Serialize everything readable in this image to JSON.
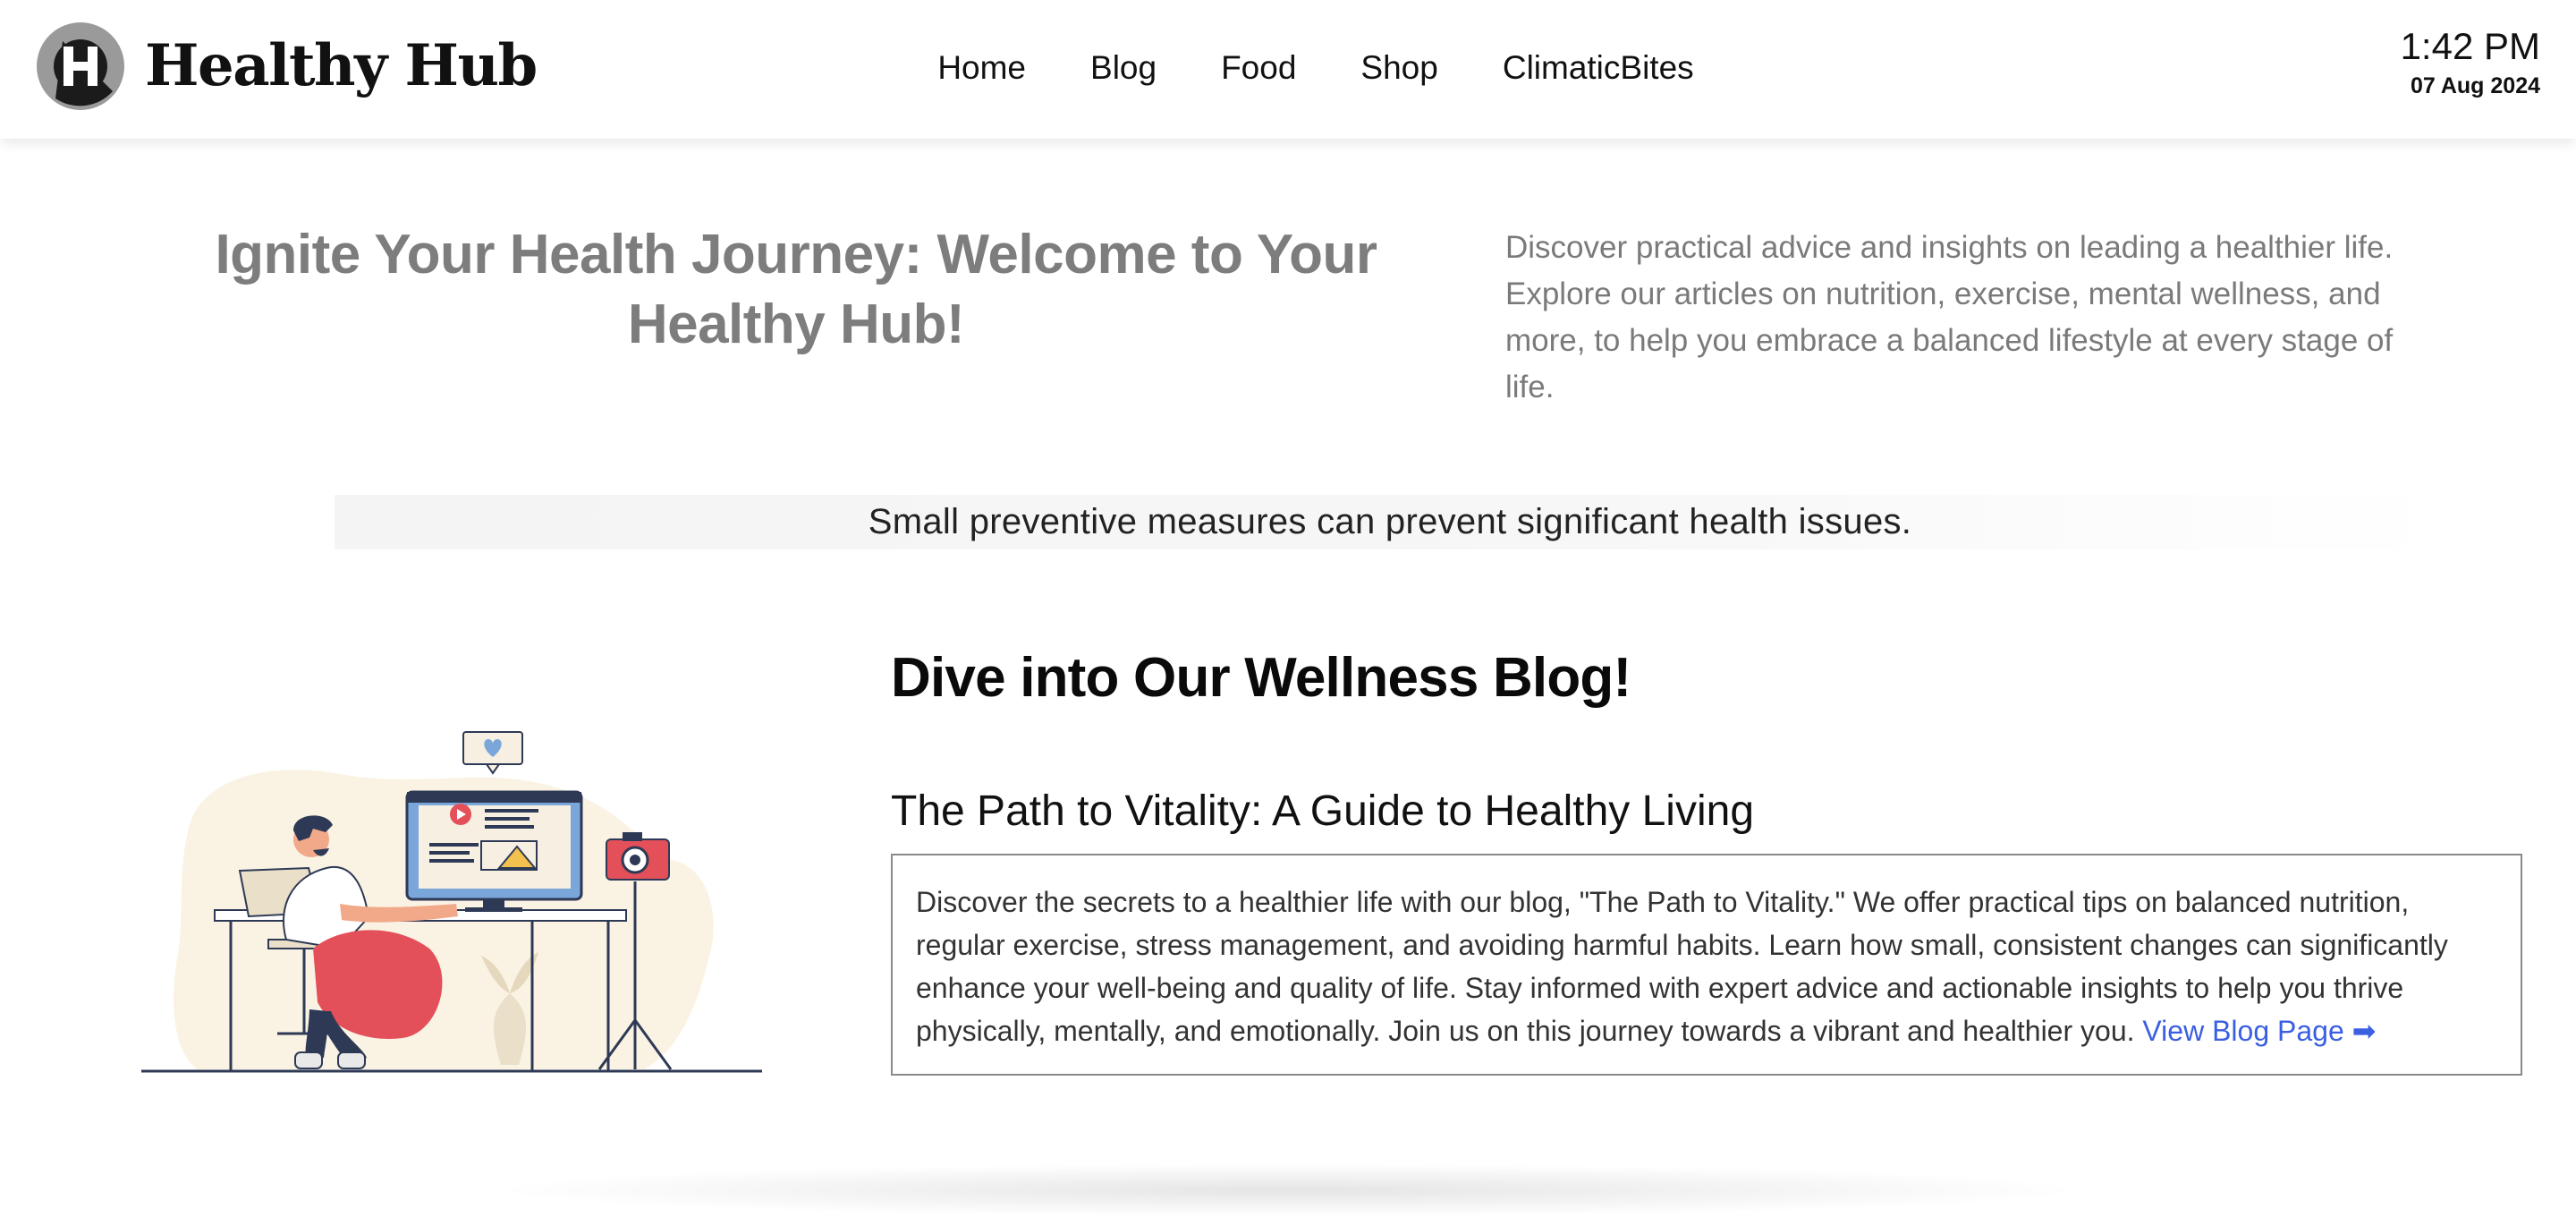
{
  "header": {
    "logo_text": "Healthy Hub",
    "logo_letter": "H",
    "nav": [
      {
        "label": "Home"
      },
      {
        "label": "Blog"
      },
      {
        "label": "Food"
      },
      {
        "label": "Shop"
      },
      {
        "label": "ClimaticBites"
      }
    ],
    "clock": {
      "time": "1:42 PM",
      "date": "07 Aug 2024"
    }
  },
  "hero": {
    "title": "Ignite Your Health Journey: Welcome to Your Healthy Hub!",
    "description": "Discover practical advice and insights on leading a healthier life. Explore our articles on nutrition, exercise, mental wellness, and more, to help you embrace a balanced lifestyle at every stage of life."
  },
  "tip": {
    "text": "Small preventive measures can prevent significant health issues."
  },
  "blog": {
    "heading": "Dive into Our Wellness Blog!",
    "post_title": "The Path to Vitality: A Guide to Healthy Living",
    "post_body": "Discover the secrets to a healthier life with our blog, \"The Path to Vitality.\" We offer practical tips on balanced nutrition, regular exercise, stress management, and avoiding harmful habits. Learn how small, consistent changes can significantly enhance your well-being and quality of life. Stay informed with expert advice and actionable insights to help you thrive physically, mentally, and emotionally. Join us on this journey towards a vibrant and healthier you.",
    "link_label": "View Blog Page ➡"
  },
  "colors": {
    "accent_link": "#3a5fe0",
    "hero_text": "#7d7d7d",
    "figure_red": "#e4505a",
    "figure_skin": "#f2a98a",
    "blob_fill": "#faf3e4",
    "screen_blue": "#7aa6da"
  },
  "icons": {
    "logo": "h-logo-icon",
    "illustration": "person-at-computer-illustration"
  }
}
